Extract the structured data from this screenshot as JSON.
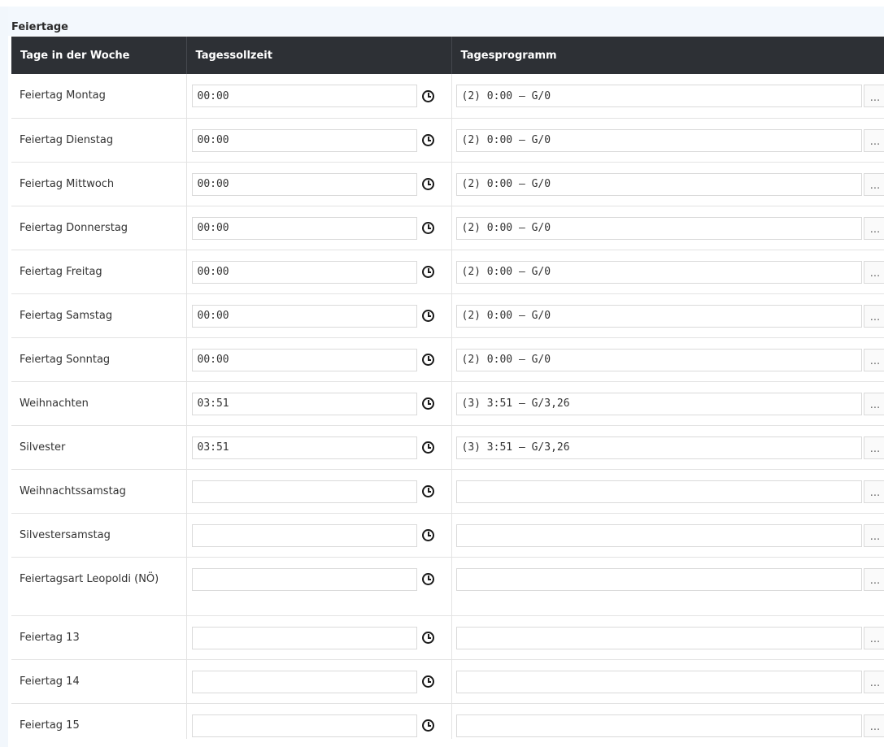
{
  "section": {
    "title": "Feiertage"
  },
  "table": {
    "headers": [
      "Tage in der Woche",
      "Tagessollzeit",
      "Tagesprogramm"
    ],
    "rows": [
      {
        "day": "Feiertag Montag",
        "time": "00:00",
        "program": "(2) 0:00 – G/0"
      },
      {
        "day": "Feiertag Dienstag",
        "time": "00:00",
        "program": "(2) 0:00 – G/0"
      },
      {
        "day": "Feiertag Mittwoch",
        "time": "00:00",
        "program": "(2) 0:00 – G/0"
      },
      {
        "day": "Feiertag Donnerstag",
        "time": "00:00",
        "program": "(2) 0:00 – G/0"
      },
      {
        "day": "Feiertag Freitag",
        "time": "00:00",
        "program": "(2) 0:00 – G/0"
      },
      {
        "day": "Feiertag Samstag",
        "time": "00:00",
        "program": "(2) 0:00 – G/0"
      },
      {
        "day": "Feiertag Sonntag",
        "time": "00:00",
        "program": "(2) 0:00 – G/0"
      },
      {
        "day": "Weihnachten",
        "time": "03:51",
        "program": "(3) 3:51 – G/3,26"
      },
      {
        "day": "Silvester",
        "time": "03:51",
        "program": "(3) 3:51 – G/3,26"
      },
      {
        "day": "Weihnachtssamstag",
        "time": "",
        "program": ""
      },
      {
        "day": "Silvestersamstag",
        "time": "",
        "program": ""
      },
      {
        "day": "Feiertagsart Leopoldi (NÖ)",
        "time": "",
        "program": ""
      },
      {
        "day": "Feiertag 13",
        "time": "",
        "program": ""
      },
      {
        "day": "Feiertag 14",
        "time": "",
        "program": ""
      },
      {
        "day": "Feiertag 15",
        "time": "",
        "program": ""
      }
    ],
    "more_label": "...",
    "clock_icon": "clock-icon",
    "more_icon": "ellipsis-icon"
  }
}
